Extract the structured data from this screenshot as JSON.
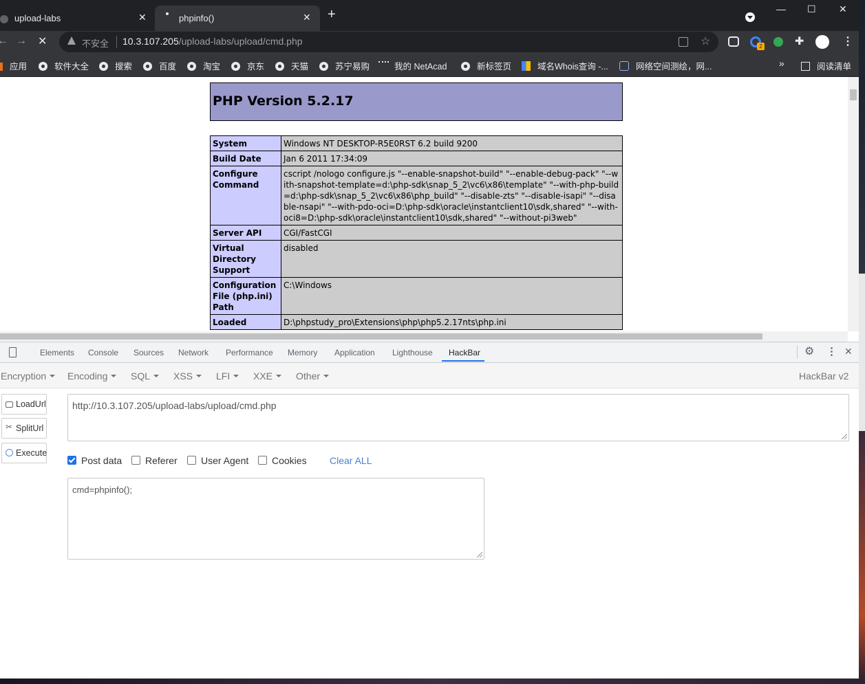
{
  "browser": {
    "tabs": [
      {
        "title": "upload-labs"
      },
      {
        "title": "phpinfo()"
      }
    ],
    "address": {
      "security_label": "不安全",
      "url_host": "10.3.107.205",
      "url_path": "/upload-labs/upload/cmd.php"
    },
    "bookmarks": [
      {
        "label": "应用"
      },
      {
        "label": "软件大全"
      },
      {
        "label": "搜索"
      },
      {
        "label": "百度"
      },
      {
        "label": "淘宝"
      },
      {
        "label": "京东"
      },
      {
        "label": "天猫"
      },
      {
        "label": "苏宁易购"
      },
      {
        "label": "我的 NetAcad"
      },
      {
        "label": "新标签页"
      },
      {
        "label": "域名Whois查询 -..."
      },
      {
        "label": "网络空间测绘，网..."
      }
    ],
    "bookmarks_overflow": "»",
    "reading_list": "阅读清单",
    "extension_badge": "2"
  },
  "phpinfo": {
    "version_title": "PHP Version 5.2.17",
    "rows": [
      {
        "key": "System",
        "value": "Windows NT DESKTOP-R5E0RST 6.2 build 9200"
      },
      {
        "key": "Build Date",
        "value": "Jan 6 2011 17:34:09"
      },
      {
        "key": "Configure Command",
        "value": "cscript /nologo configure.js \"--enable-snapshot-build\" \"--enable-debug-pack\" \"--with-snapshot-template=d:\\php-sdk\\snap_5_2\\vc6\\x86\\template\" \"--with-php-build=d:\\php-sdk\\snap_5_2\\vc6\\x86\\php_build\" \"--disable-zts\" \"--disable-isapi\" \"--disable-nsapi\" \"--with-pdo-oci=D:\\php-sdk\\oracle\\instantclient10\\sdk,shared\" \"--with-oci8=D:\\php-sdk\\oracle\\instantclient10\\sdk,shared\" \"--without-pi3web\""
      },
      {
        "key": "Server API",
        "value": "CGI/FastCGI"
      },
      {
        "key": "Virtual Directory Support",
        "value": "disabled"
      },
      {
        "key": "Configuration File (php.ini) Path",
        "value": "C:\\Windows"
      },
      {
        "key": "Loaded",
        "value": "D:\\phpstudy_pro\\Extensions\\php\\php5.2.17nts\\php.ini"
      }
    ]
  },
  "devtools": {
    "tabs": [
      {
        "label": "Elements"
      },
      {
        "label": "Console"
      },
      {
        "label": "Sources"
      },
      {
        "label": "Network"
      },
      {
        "label": "Performance"
      },
      {
        "label": "Memory"
      },
      {
        "label": "Application"
      },
      {
        "label": "Lighthouse"
      },
      {
        "label": "HackBar"
      }
    ],
    "active_tab": "HackBar"
  },
  "hackbar": {
    "menus": [
      {
        "label": "Encryption"
      },
      {
        "label": "Encoding"
      },
      {
        "label": "SQL"
      },
      {
        "label": "XSS"
      },
      {
        "label": "LFI"
      },
      {
        "label": "XXE"
      },
      {
        "label": "Other"
      }
    ],
    "brand": "HackBar v2",
    "buttons": [
      {
        "label": "LoadUrl"
      },
      {
        "label": "SplitUrl"
      },
      {
        "label": "Execute"
      }
    ],
    "url_value": "http://10.3.107.205/upload-labs/upload/cmd.php",
    "options": [
      {
        "label": "Post data",
        "checked": true
      },
      {
        "label": "Referer",
        "checked": false
      },
      {
        "label": "User Agent",
        "checked": false
      },
      {
        "label": "Cookies",
        "checked": false
      }
    ],
    "clear_all": "Clear ALL",
    "post_body": "cmd=phpinfo();"
  },
  "colors": {
    "php_header": "#9999cc",
    "php_key": "#ccccff",
    "php_value": "#cccccc",
    "accent": "#1a73e8"
  }
}
